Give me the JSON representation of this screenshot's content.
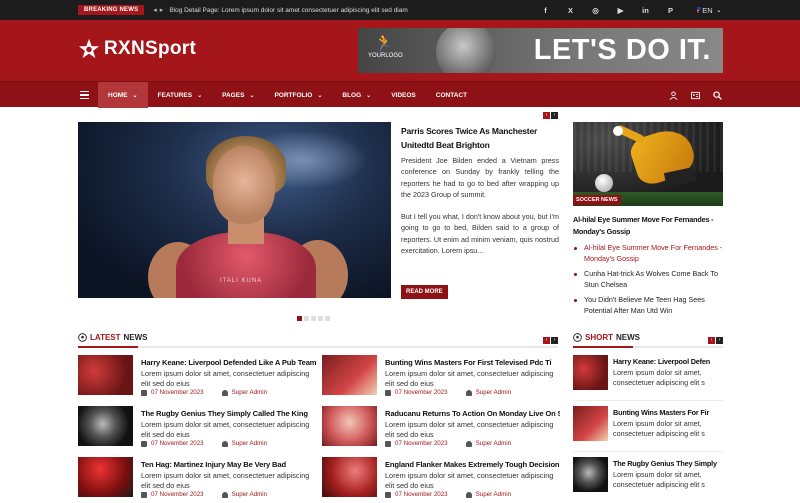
{
  "topbar": {
    "breaking_label": "BREAKING NEWS",
    "ticker_text": "Blog Detail Page: Lorem ipsum dolor sit amet consectetuer adipiscing elit sed diam",
    "socials": [
      "f",
      "X",
      "ig",
      "yt",
      "in",
      "p"
    ],
    "language": "EN"
  },
  "header": {
    "logo_text": "RXNSport",
    "banner": {
      "logo_label": "YOURLOGO",
      "slogan": "LET'S DO IT."
    }
  },
  "nav": {
    "items": [
      {
        "label": "HOME",
        "dropdown": true,
        "active": true
      },
      {
        "label": "FEATURES",
        "dropdown": true
      },
      {
        "label": "PAGES",
        "dropdown": true
      },
      {
        "label": "PORTFOLIO",
        "dropdown": true
      },
      {
        "label": "BLOG",
        "dropdown": true
      },
      {
        "label": "VIDEOS",
        "dropdown": false
      },
      {
        "label": "CONTACT",
        "dropdown": false
      }
    ],
    "icons": [
      "user-icon",
      "id-card-icon",
      "search-icon"
    ]
  },
  "hero": {
    "title": "Parris Scores Twice As Manchester Unitedtd Beat Brighton",
    "paragraph1": "President Joe Bilden ended a Vietnam press conference on Sunday by frankly telling the reporters he had to go to bed after wrapping up the 2023 Group of summit.",
    "paragraph2": "But I tell you what, I don't know about you, but I'm going to go to bed, Bilden said to a group of reporters. Ut enim ad minim veniam, quis nostrud exercitation. Lorem ipsu...",
    "read_more": "READ MORE",
    "jersey_text": "ITALI KUNA",
    "slide_count": 5,
    "active_slide": 1
  },
  "side_feature": {
    "tag": "SOCCER NEWS",
    "title": "Al-hilal Eye Summer Move For Fernandes - Monday's Gossip",
    "list": [
      {
        "text": "Al-hilal Eye Summer Move For Fernandes - Monday's Gossip",
        "highlight": true
      },
      {
        "text": "Cunha Hat-trick As Wolves Come Back To Stun Chelsea",
        "highlight": false
      },
      {
        "text": "You Didn't Believe Me Teen Hag Sees Potential After Man Utd Win",
        "highlight": false
      }
    ]
  },
  "latest": {
    "heading_accent": "LATEST",
    "heading_rest": "NEWS",
    "items": [
      {
        "title": "Harry Keane: Liverpool Defended Like A Pub Team",
        "desc": "Lorem ipsum dolor sit amet, consectetuer adipiscing elit sed do eius",
        "date": "07 November 2023",
        "author": "Super Admin"
      },
      {
        "title": "Bunting Wins Masters For First Televised Pdc Ti",
        "desc": "Lorem ipsum dolor sit amet, consectetuer adipiscing elit sed do eius",
        "date": "07 November 2023",
        "author": "Super Admin"
      },
      {
        "title": "The Rugby Genius They Simply Called The King",
        "desc": "Lorem ipsum dolor sit amet, consectetuer adipiscing elit sed do eius",
        "date": "07 November 2023",
        "author": "Super Admin"
      },
      {
        "title": "Raducanu Returns To Action On Monday Live On Sk",
        "desc": "Lorem ipsum dolor sit amet, consectetuer adipiscing elit sed do eius",
        "date": "07 November 2023",
        "author": "Super Admin"
      },
      {
        "title": "Ten Hag: Martinez Injury May Be Very Bad",
        "desc": "Lorem ipsum dolor sit amet, consectetuer adipiscing elit sed do eius",
        "date": "07 November 2023",
        "author": "Super Admin"
      },
      {
        "title": "England Flanker Makes Extremely Tough Decision",
        "desc": "Lorem ipsum dolor sit amet, consectetuer adipiscing elit sed do eius",
        "date": "07 November 2023",
        "author": "Super Admin"
      }
    ]
  },
  "short_news": {
    "heading_accent": "SHORT",
    "heading_rest": "NEWS",
    "items": [
      {
        "title": "Harry Keane: Liverpool Defen",
        "desc1": "Lorem ipsum dolor sit amet,",
        "desc2": "consectetuer adipiscing elit s"
      },
      {
        "title": "Bunting Wins Masters For Fir",
        "desc1": "Lorem ipsum dolor sit amet,",
        "desc2": "consectetuer adipiscing elit s"
      },
      {
        "title": "The Rugby Genius They Simply",
        "desc1": "Lorem ipsum dolor sit amet,",
        "desc2": "consectetuer adipiscing elit s"
      }
    ]
  },
  "colors": {
    "brand": "#a4161a",
    "nav": "#8e1116",
    "topbar": "#1c1c1c"
  }
}
